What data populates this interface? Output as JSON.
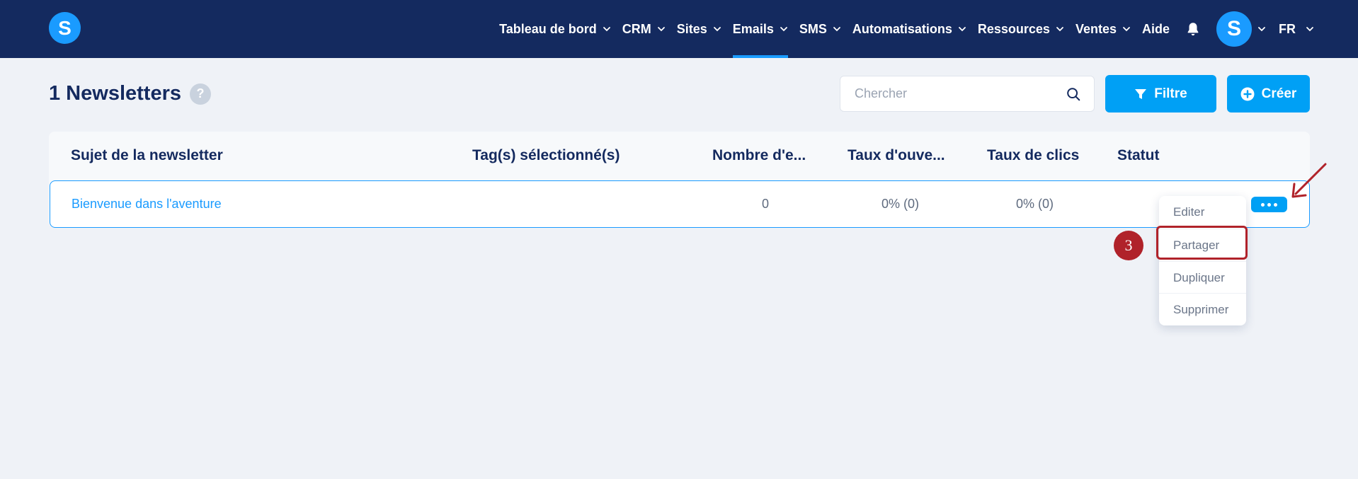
{
  "app": {
    "logo_letter": "S",
    "brand_color": "#1a9bff",
    "nav_color": "#142a5f"
  },
  "nav": {
    "items": [
      {
        "label": "Tableau de bord",
        "has_dropdown": true,
        "active": false
      },
      {
        "label": "CRM",
        "has_dropdown": true,
        "active": false
      },
      {
        "label": "Sites",
        "has_dropdown": true,
        "active": false
      },
      {
        "label": "Emails",
        "has_dropdown": true,
        "active": true
      },
      {
        "label": "SMS",
        "has_dropdown": true,
        "active": false
      },
      {
        "label": "Automatisations",
        "has_dropdown": true,
        "active": false
      },
      {
        "label": "Ressources",
        "has_dropdown": true,
        "active": false
      },
      {
        "label": "Ventes",
        "has_dropdown": true,
        "active": false
      },
      {
        "label": "Aide",
        "has_dropdown": false,
        "active": false
      }
    ],
    "avatar_letter": "S",
    "language": "FR",
    "icons": [
      "bell-icon",
      "chevron-down-icon"
    ]
  },
  "page": {
    "title": "1 Newsletters",
    "help": "?"
  },
  "toolbar": {
    "search_placeholder": "Chercher",
    "filter_label": "Filtre",
    "create_label": "Créer"
  },
  "table": {
    "headers": [
      "Sujet de la newsletter",
      "Tag(s) sélectionné(s)",
      "Nombre d'e...",
      "Taux d'ouve...",
      "Taux de clics",
      "Statut"
    ],
    "rows": [
      {
        "subject": "Bienvenue dans l'aventure",
        "tags": "",
        "count": "0",
        "open_rate": "0% (0)",
        "click_rate": "0% (0)",
        "status": ""
      }
    ]
  },
  "menu": {
    "items": [
      "Editer",
      "Partager",
      "Dupliquer",
      "Supprimer"
    ],
    "highlighted": "Partager"
  },
  "annotation": {
    "step": "3",
    "color": "#b0222a"
  }
}
